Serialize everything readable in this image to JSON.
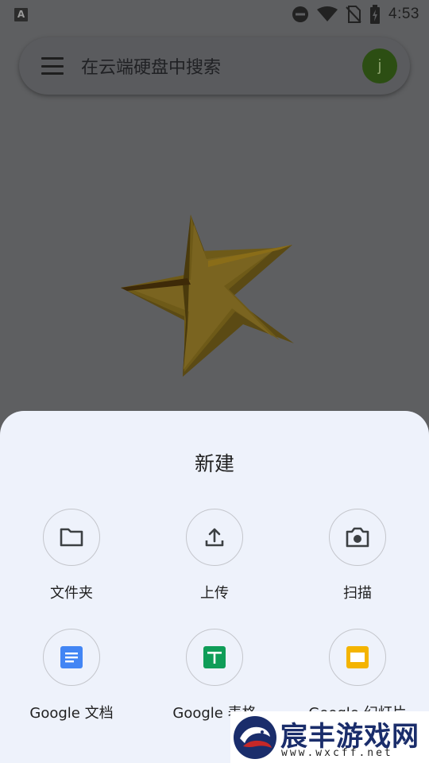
{
  "status_bar": {
    "time": "4:53",
    "notification_icon_letter": "A"
  },
  "search": {
    "placeholder": "在云端硬盘中搜索",
    "avatar_initial": "j"
  },
  "sheet": {
    "title": "新建",
    "items": [
      {
        "label": "文件夹",
        "icon": "folder-icon"
      },
      {
        "label": "上传",
        "icon": "upload-icon"
      },
      {
        "label": "扫描",
        "icon": "camera-icon"
      },
      {
        "label": "Google 文档",
        "icon": "docs-icon",
        "color": "#4285f4"
      },
      {
        "label": "Google 表格",
        "icon": "sheets-icon",
        "color": "#0f9d58"
      },
      {
        "label": "Google 幻灯片",
        "icon": "slides-icon",
        "color": "#f4b400"
      }
    ]
  },
  "watermark": {
    "title": "宸丰游戏网",
    "url": "www.wxcff.net"
  }
}
